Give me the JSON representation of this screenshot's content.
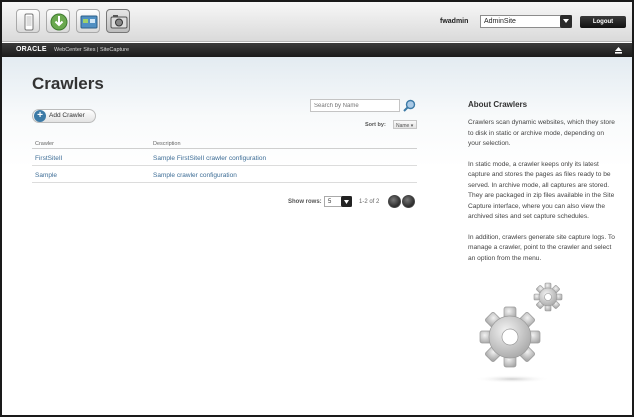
{
  "user": {
    "name": "fwadmin"
  },
  "site_select": {
    "value": "AdminSite"
  },
  "logout_label": "Logout",
  "brand": {
    "oracle": "ORACLE",
    "product": "WebCenter Sites | SiteCapture"
  },
  "page": {
    "title": "Crawlers"
  },
  "add_crawler_label": "Add Crawler",
  "search": {
    "placeholder": "Search by Name"
  },
  "sort": {
    "label": "Sort by:",
    "value": "Name"
  },
  "table": {
    "headers": {
      "crawler": "Crawler",
      "description": "Description"
    },
    "rows": [
      {
        "name": "FirstSiteII",
        "description": "Sample FirstSiteII crawler configuration"
      },
      {
        "name": "Sample",
        "description": "Sample crawler configuration"
      }
    ]
  },
  "pager": {
    "label": "Show rows:",
    "rows_value": "5",
    "count": "1-2 of 2"
  },
  "about": {
    "title": "About Crawlers",
    "paragraphs": [
      "Crawlers scan dynamic websites, which they store to disk in static or archive mode, depending on your selection.",
      "In static mode, a crawler keeps only its latest capture and stores the pages as files ready to be served. In archive mode, all captures are stored. They are packaged in zip files available in the Site Capture interface, where you can also view the archived sites and set capture schedules.",
      "In addition, crawlers generate site capture logs. To manage a crawler, point to the crawler and select an option from the menu."
    ]
  },
  "icons": {
    "toolbar": [
      "phone-icon",
      "download-icon",
      "sites-icon",
      "camera-icon"
    ],
    "accent": "#3c7aa6"
  }
}
